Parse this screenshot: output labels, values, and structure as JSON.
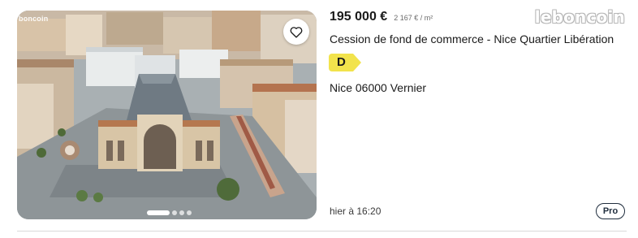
{
  "listing": {
    "price": "195 000 €",
    "price_per_m2": "2 167 € / m²",
    "title": "Cession de fond de commerce - Nice Quartier Libération",
    "energy_class": "D",
    "location": "Nice 06000 Vernier",
    "date": "hier à 16:20",
    "seller_type_badge": "Pro"
  },
  "brand": {
    "logo_text": "leboncoin",
    "photo_watermark": "boncoin"
  },
  "photo": {
    "subject": "aerial view of Nice Gare du Sud train station and market square",
    "carousel_total": 4,
    "carousel_active": 1
  },
  "icons": {
    "favorite": "heart-icon"
  },
  "colors": {
    "energy_badge": "#f2e34c",
    "pro_badge_border": "#1f2d3d",
    "divider": "#d9d9d9"
  }
}
